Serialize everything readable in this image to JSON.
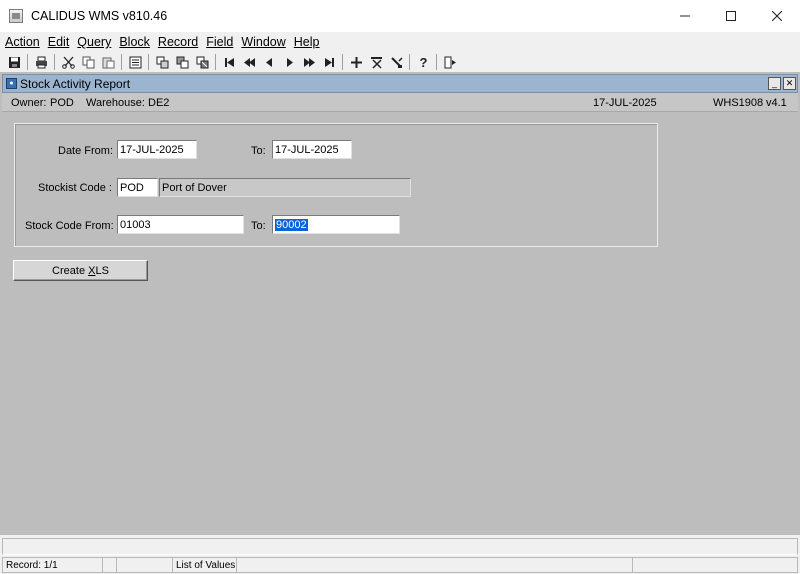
{
  "window": {
    "title": "CALIDUS WMS v810.46",
    "minimize_icon": "minimize-icon",
    "maximize_icon": "maximize-icon",
    "close_icon": "close-icon"
  },
  "menu": {
    "items": [
      "Action",
      "Edit",
      "Query",
      "Block",
      "Record",
      "Field",
      "Window",
      "Help"
    ]
  },
  "toolbar": {
    "icons": [
      "save-icon",
      "print-icon",
      "cut-icon",
      "copy-icon",
      "paste-icon",
      "list-icon",
      "duplicate-record-icon",
      "duplicate-field-icon",
      "clear-field-icon",
      "first-record-icon",
      "previous-set-icon",
      "previous-record-icon",
      "next-record-icon",
      "next-set-icon",
      "last-record-icon",
      "insert-record-icon",
      "delete-record-icon",
      "edit-icon",
      "help-icon",
      "exit-icon"
    ]
  },
  "form": {
    "title": "Stock Activity Report",
    "owner_label": "Owner:",
    "owner": "POD",
    "warehouse_label": "Warehouse:",
    "warehouse": "DE2",
    "date": "17-JUL-2025",
    "module": "WHS1908",
    "version": "v4.1",
    "date_from_label": "Date From:",
    "date_from": "17-JUL-2025",
    "date_to_label": "To:",
    "date_to": "17-JUL-2025",
    "stockist_label": "Stockist Code :",
    "stockist_code": "POD",
    "stockist_name": "Port of Dover",
    "stock_from_label": "Stock Code From:",
    "stock_from": "01003",
    "stock_to_label": "To:",
    "stock_to": "90002",
    "create_xls_prefix": "Create ",
    "create_xls_underlined": "X",
    "create_xls_suffix": "LS"
  },
  "status": {
    "record": "Record: 1/1",
    "list_of_values": "List of Values"
  },
  "colors": {
    "mdi_background": "#bdbdbd",
    "inner_title": "#9bb4cf",
    "selection": "#0a64d8"
  }
}
